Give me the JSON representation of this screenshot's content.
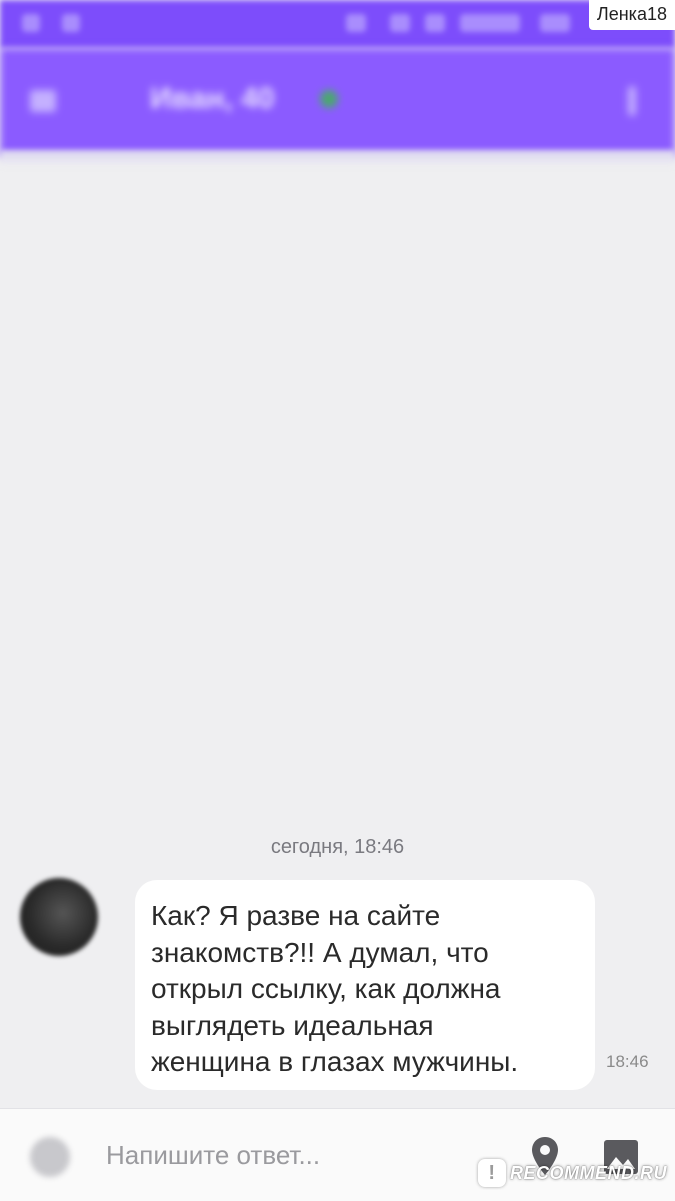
{
  "watermark_user": "Ленка18",
  "header": {
    "title": "Иван, 40"
  },
  "chat": {
    "date_separator": "сегодня, 18:46",
    "messages": [
      {
        "lines": [
          "Как? Я разве на сайте",
          "знакомств?!! А думал, что",
          "открыл ссылку, как должна",
          "выглядеть идеальная",
          "женщина в глазах мужчины."
        ],
        "time": "18:46"
      }
    ]
  },
  "composer": {
    "placeholder": "Напишите ответ..."
  },
  "brand": {
    "badge": "!",
    "text": "RECOMMEND.RU"
  },
  "colors": {
    "accent": "#8b5bff",
    "chat_bg": "#efeff1",
    "bubble": "#ffffff"
  },
  "icons": [
    "back-icon",
    "online-status-icon",
    "more-menu-icon",
    "attach-icon",
    "location-icon",
    "gallery-icon"
  ]
}
